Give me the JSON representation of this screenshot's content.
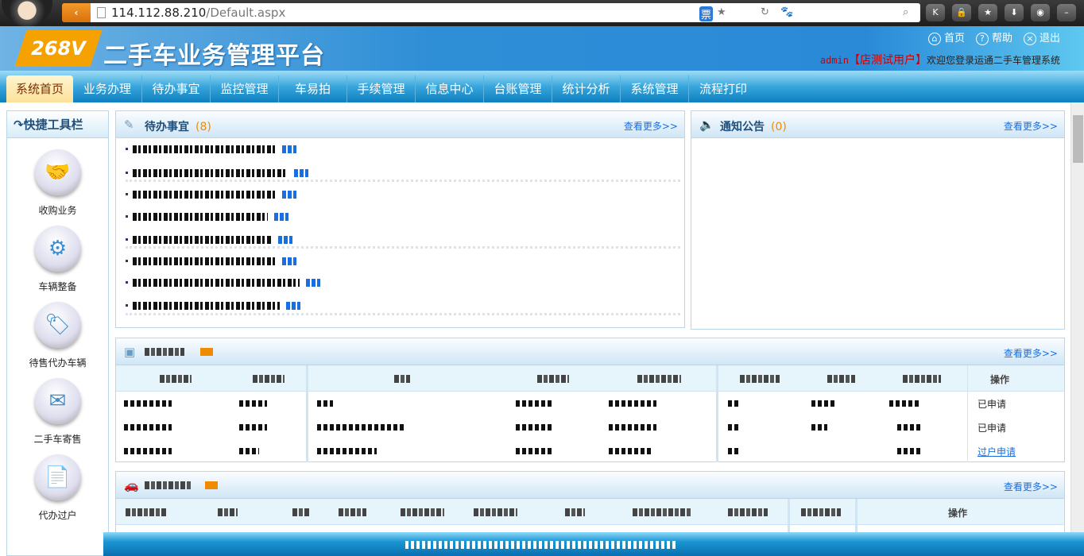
{
  "browser": {
    "url_host": "114.112.88.210",
    "url_path": "/Default.aspx",
    "buttons": [
      "K",
      "lock",
      "star",
      "download",
      "game",
      "menu"
    ]
  },
  "header": {
    "logo": "268V",
    "site_name": "二手车业务管理平台",
    "links": [
      {
        "icon": "home-icon",
        "label": "首页"
      },
      {
        "icon": "help-icon",
        "label": "帮助"
      },
      {
        "icon": "logout-icon",
        "label": "退出"
      }
    ],
    "user": "admin",
    "role": "【店测试用户】",
    "welcome": "欢迎您登录运通二手车管理系统"
  },
  "nav": [
    "系统首页",
    "业务办理",
    "待办事宜",
    "监控管理",
    "车易拍",
    "手续管理",
    "信息中心",
    "台账管理",
    "统计分析",
    "系统管理",
    "流程打印"
  ],
  "sidebar": {
    "title": "快捷工具栏",
    "items": [
      "收购业务",
      "车辆整备",
      "待售代办车辆",
      "二手车寄售",
      "代办过户"
    ]
  },
  "todo": {
    "title": "待办事宜",
    "count": "(8)",
    "more": "查看更多>>"
  },
  "notice": {
    "title": "通知公告",
    "count": "(0)",
    "more": "查看更多>>"
  },
  "section2": {
    "more": "查看更多>>",
    "op_header": "操作",
    "ops": [
      "已申请",
      "已申请",
      "过户申请"
    ]
  },
  "section3": {
    "more": "查看更多>>",
    "op_header": "操作"
  },
  "colors": {
    "accent": "#2a8ad8",
    "link": "#1a6fe0",
    "count": "#f08a00"
  }
}
